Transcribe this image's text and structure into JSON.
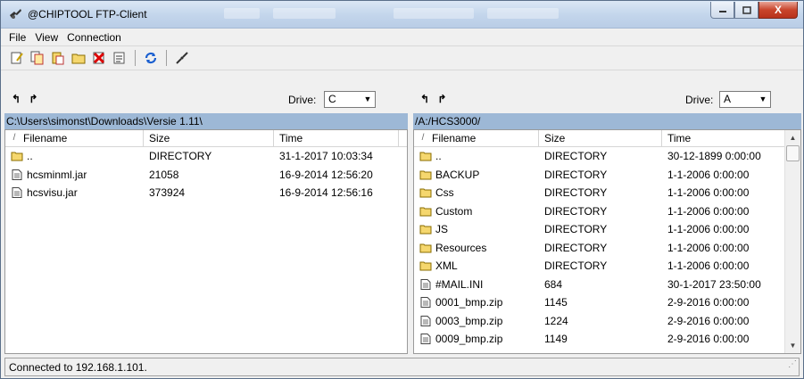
{
  "window": {
    "title": "@CHIPTOOL FTP-Client",
    "minimize": "–",
    "maximize": "□",
    "close": "X"
  },
  "menu": [
    {
      "label": "File"
    },
    {
      "label": "View"
    },
    {
      "label": "Connection"
    }
  ],
  "toolbar": [
    {
      "icon": "edit-icon"
    },
    {
      "icon": "copy-icon"
    },
    {
      "icon": "paste-icon"
    },
    {
      "icon": "new-folder-icon"
    },
    {
      "icon": "delete-icon"
    },
    {
      "icon": "properties-icon"
    },
    {
      "icon": "refresh-icon"
    },
    {
      "icon": "disconnect-icon"
    }
  ],
  "left": {
    "nav": "↰ ↱",
    "drive_label": "Drive:",
    "drive_value": "C",
    "path": "C:\\Users\\simonst\\Downloads\\Versie 1.11\\",
    "columns": [
      "Filename",
      "Size",
      "Time"
    ],
    "rows": [
      {
        "type": "folder",
        "name": "..",
        "size": "DIRECTORY",
        "time": "31-1-2017 10:03:34"
      },
      {
        "type": "file",
        "name": "hcsminml.jar",
        "size": "21058",
        "time": "16-9-2014 12:56:20"
      },
      {
        "type": "file",
        "name": "hcsvisu.jar",
        "size": "373924",
        "time": "16-9-2014 12:56:16"
      }
    ]
  },
  "right": {
    "nav": "↰ ↱",
    "drive_label": "Drive:",
    "drive_value": "A",
    "path": "/A:/HCS3000/",
    "columns": [
      "Filename",
      "Size",
      "Time"
    ],
    "rows": [
      {
        "type": "folder",
        "name": "..",
        "size": "DIRECTORY",
        "time": "30-12-1899 0:00:00"
      },
      {
        "type": "folder",
        "name": "BACKUP",
        "size": "DIRECTORY",
        "time": "1-1-2006 0:00:00"
      },
      {
        "type": "folder",
        "name": "Css",
        "size": "DIRECTORY",
        "time": "1-1-2006 0:00:00"
      },
      {
        "type": "folder",
        "name": "Custom",
        "size": "DIRECTORY",
        "time": "1-1-2006 0:00:00"
      },
      {
        "type": "folder",
        "name": "JS",
        "size": "DIRECTORY",
        "time": "1-1-2006 0:00:00"
      },
      {
        "type": "folder",
        "name": "Resources",
        "size": "DIRECTORY",
        "time": "1-1-2006 0:00:00"
      },
      {
        "type": "folder",
        "name": "XML",
        "size": "DIRECTORY",
        "time": "1-1-2006 0:00:00"
      },
      {
        "type": "file",
        "name": "#MAIL.INI",
        "size": "684",
        "time": "30-1-2017 23:50:00"
      },
      {
        "type": "file",
        "name": "0001_bmp.zip",
        "size": "1145",
        "time": "2-9-2016 0:00:00"
      },
      {
        "type": "file",
        "name": "0003_bmp.zip",
        "size": "1224",
        "time": "2-9-2016 0:00:00"
      },
      {
        "type": "file",
        "name": "0009_bmp.zip",
        "size": "1149",
        "time": "2-9-2016 0:00:00"
      }
    ]
  },
  "status": "Connected to 192.168.1.101.",
  "colors": {
    "path_bar": "#9db8d6",
    "folder": "#f5d76e",
    "title_bar": "#c4d6ec"
  }
}
